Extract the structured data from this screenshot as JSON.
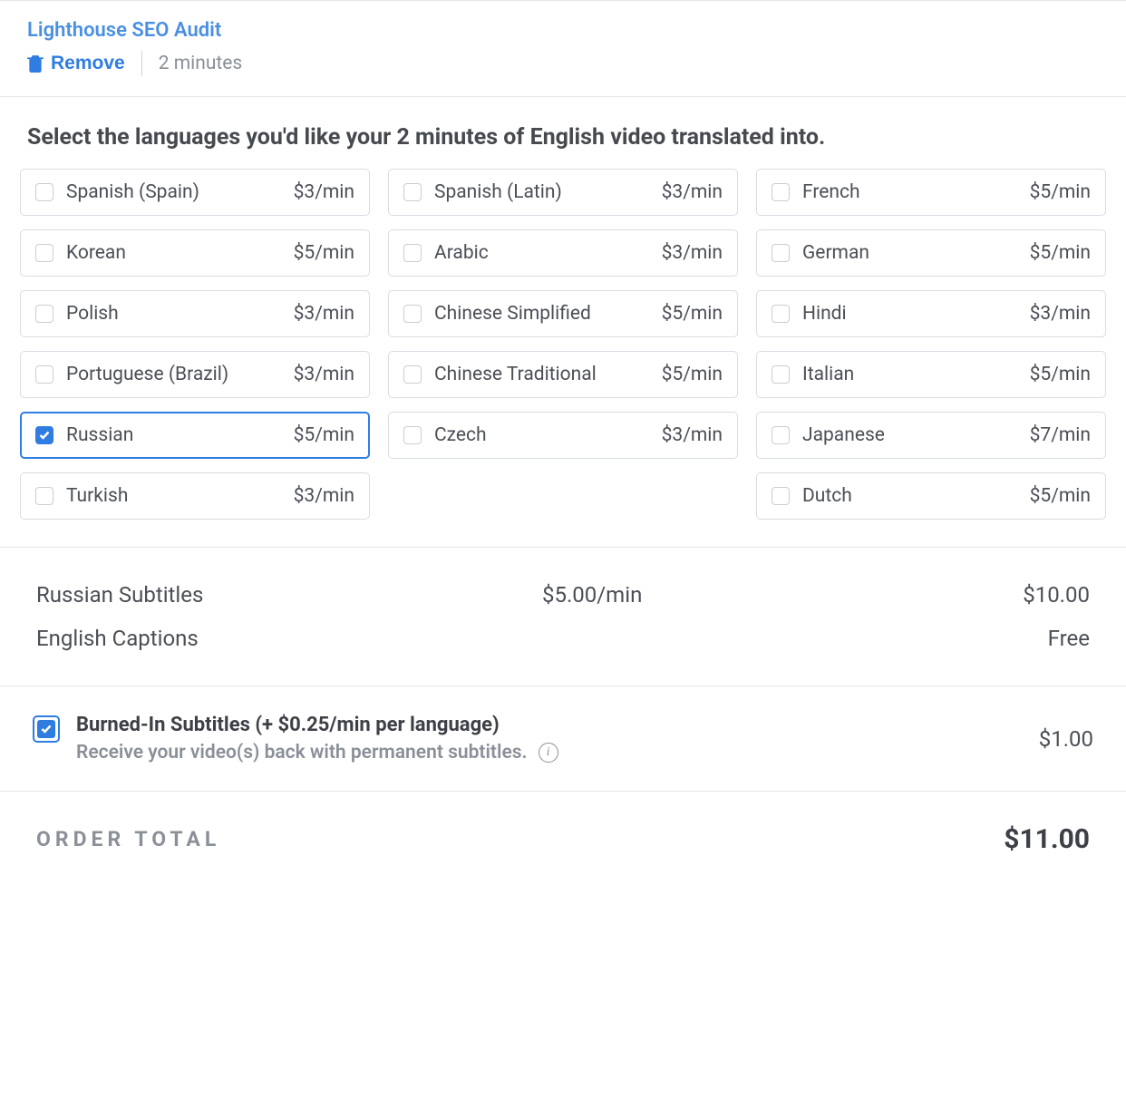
{
  "header": {
    "title": "Lighthouse SEO Audit",
    "remove_label": "Remove",
    "duration": "2 minutes"
  },
  "instruction": "Select the languages you'd like your 2 minutes of English video translated into.",
  "languages": [
    {
      "name": "Spanish (Spain)",
      "price": "$3/min",
      "checked": false
    },
    {
      "name": "Spanish (Latin)",
      "price": "$3/min",
      "checked": false
    },
    {
      "name": "French",
      "price": "$5/min",
      "checked": false
    },
    {
      "name": "Korean",
      "price": "$5/min",
      "checked": false
    },
    {
      "name": "Arabic",
      "price": "$3/min",
      "checked": false
    },
    {
      "name": "German",
      "price": "$5/min",
      "checked": false
    },
    {
      "name": "Polish",
      "price": "$3/min",
      "checked": false
    },
    {
      "name": "Chinese Simplified",
      "price": "$5/min",
      "checked": false
    },
    {
      "name": "Hindi",
      "price": "$3/min",
      "checked": false
    },
    {
      "name": "Portuguese (Brazil)",
      "price": "$3/min",
      "checked": false
    },
    {
      "name": "Chinese Traditional",
      "price": "$5/min",
      "checked": false
    },
    {
      "name": "Italian",
      "price": "$5/min",
      "checked": false
    },
    {
      "name": "Russian",
      "price": "$5/min",
      "checked": true
    },
    {
      "name": "Czech",
      "price": "$3/min",
      "checked": false
    },
    {
      "name": "Japanese",
      "price": "$7/min",
      "checked": false
    },
    {
      "name": "Turkish",
      "price": "$3/min",
      "checked": false
    },
    {
      "name": "",
      "price": "",
      "checked": false,
      "empty": true
    },
    {
      "name": "Dutch",
      "price": "$5/min",
      "checked": false
    }
  ],
  "summary": [
    {
      "label": "Russian Subtitles",
      "rate": "$5.00/min",
      "amount": "$10.00"
    },
    {
      "label": "English Captions",
      "rate": "",
      "amount": "Free"
    }
  ],
  "addon": {
    "title": "Burned-In Subtitles (+ $0.25/min per language)",
    "desc": "Receive your video(s) back with permanent subtitles.",
    "price": "$1.00",
    "checked": true
  },
  "total": {
    "label": "ORDER TOTAL",
    "amount": "$11.00"
  }
}
